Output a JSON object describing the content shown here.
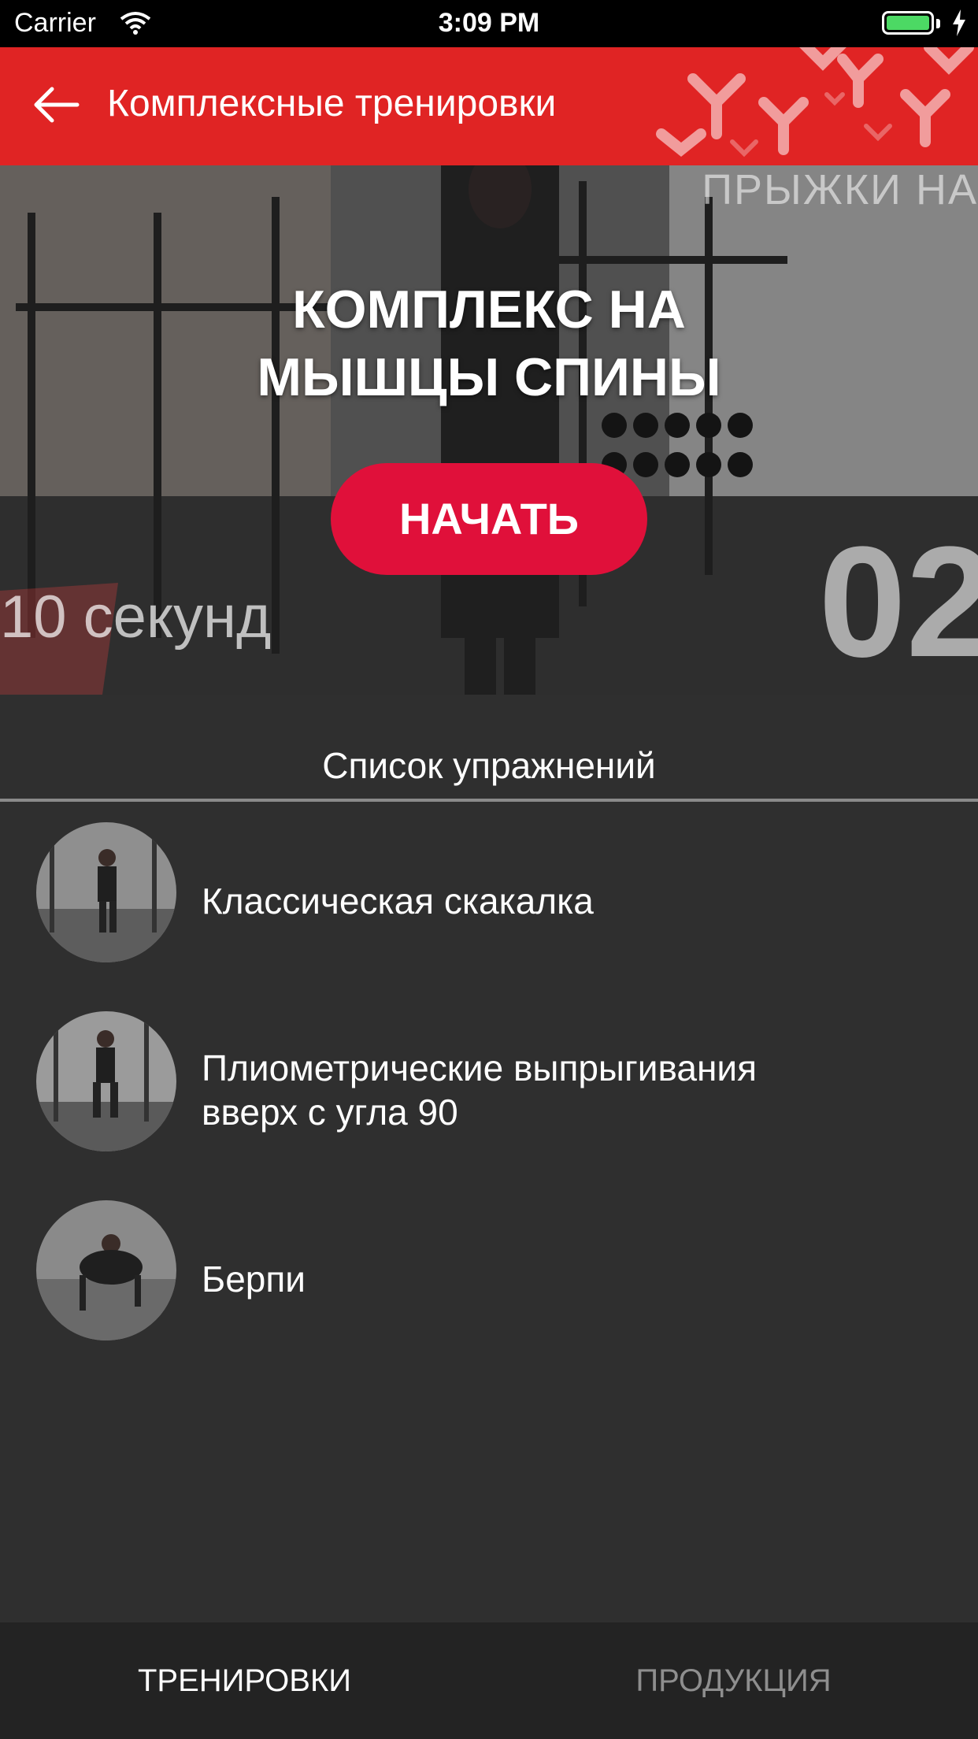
{
  "status_bar": {
    "carrier": "Carrier",
    "time": "3:09 PM"
  },
  "navbar": {
    "title": "Комплексные тренировки",
    "back_icon": "arrow-left-icon",
    "accent_color": "#e02424"
  },
  "hero": {
    "headline_line1": "КОМПЛЕКС НА",
    "headline_line2": "МЫШЦЫ СПИНЫ",
    "start_label": "НАЧАТЬ",
    "overlay_top_text": "ПРЫЖКИ НА",
    "overlay_seconds_number": "10",
    "overlay_seconds_word": "секунд",
    "overlay_big_number": "02",
    "button_color": "#e0103a"
  },
  "exercise_list": {
    "header": "Список упражнений",
    "items": [
      {
        "line1": "Классическая скакалка",
        "line2": ""
      },
      {
        "line1": "Плиометрические выпрыгивания",
        "line2": "вверх с угла 90"
      },
      {
        "line1": "Берпи",
        "line2": ""
      }
    ]
  },
  "tab_bar": {
    "tabs": [
      {
        "label": "ТРЕНИРОВКИ",
        "active": true
      },
      {
        "label": "ПРОДУКЦИЯ",
        "active": false
      }
    ]
  }
}
